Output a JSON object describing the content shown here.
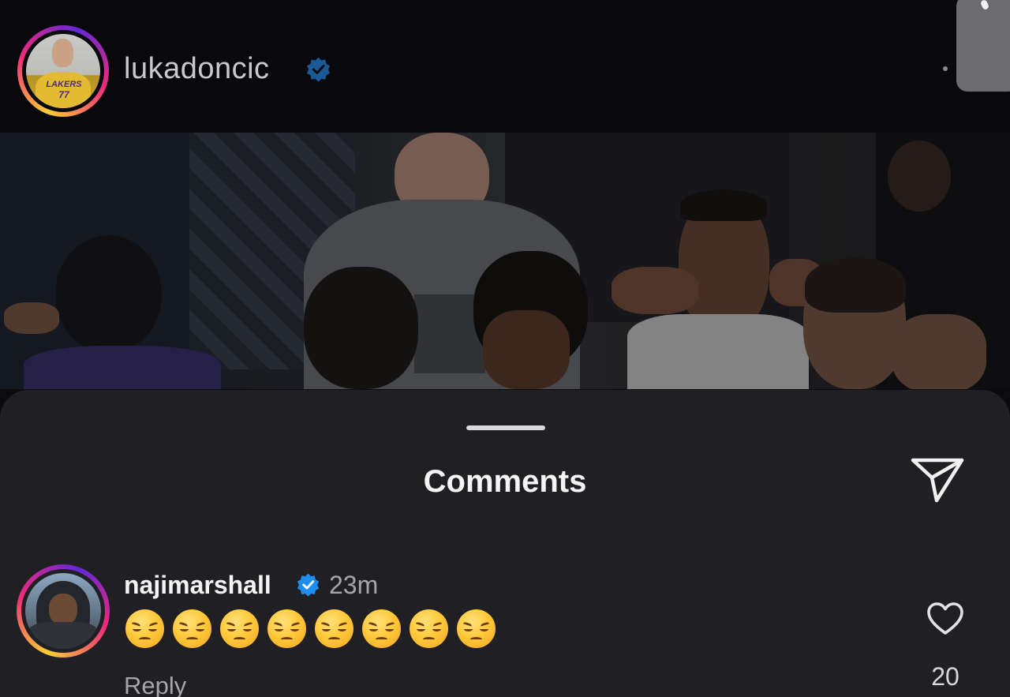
{
  "post": {
    "username": "lukadoncic",
    "avatar_jersey_text": "LAKERS",
    "avatar_jersey_number": "77",
    "verified": true
  },
  "comments_sheet": {
    "title": "Comments",
    "send_icon": "paper-plane-icon"
  },
  "comment": {
    "username": "najimarshall",
    "verified": true,
    "time": "23m",
    "emojis": [
      "😔",
      "😔",
      "😔",
      "😔",
      "😔",
      "😔",
      "😔",
      "😔"
    ],
    "reply_label": "Reply",
    "like_icon": "heart-outline-icon",
    "likes": "20"
  },
  "colors": {
    "verified_blue": "#1d8ef0",
    "sheet_background": "#202024",
    "header_background": "#09090d"
  }
}
